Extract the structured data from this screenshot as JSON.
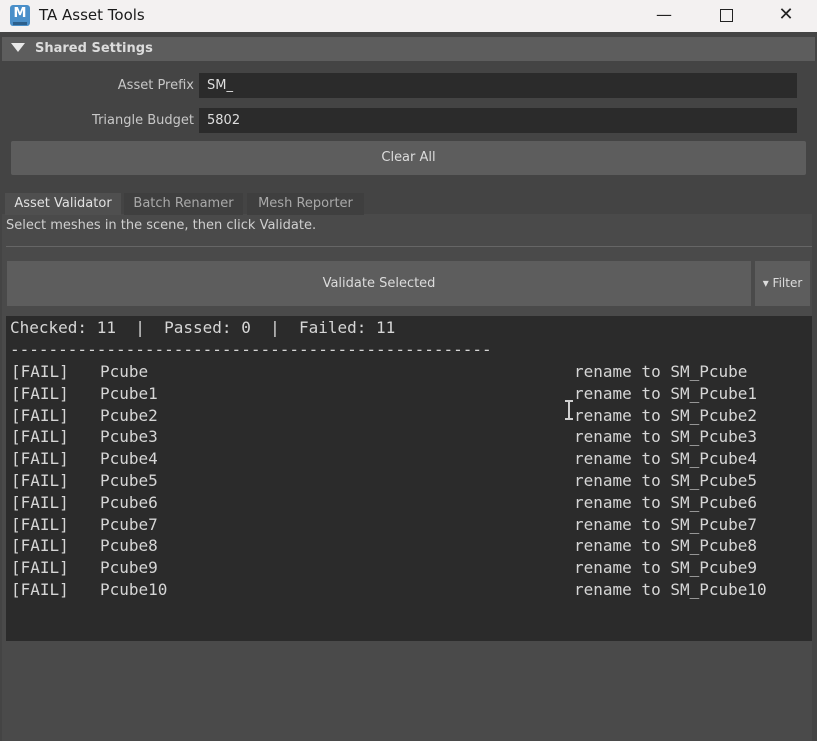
{
  "window": {
    "title": "TA Asset Tools",
    "app_icon": "maya-icon",
    "app_icon_letter": "M",
    "minimize_icon": "—",
    "close_icon": "✕"
  },
  "shared_settings": {
    "header": "Shared Settings",
    "asset_prefix_label": "Asset Prefix",
    "asset_prefix_value": "SM_",
    "triangle_budget_label": "Triangle Budget",
    "triangle_budget_value": "5802",
    "clear_all_label": "Clear All"
  },
  "tabs": [
    {
      "label": "Asset Validator",
      "active": true
    },
    {
      "label": "Batch Renamer",
      "active": false
    },
    {
      "label": "Mesh Reporter",
      "active": false
    }
  ],
  "validator": {
    "hint": "Select meshes in the scene, then click Validate.",
    "validate_label": "Validate Selected",
    "filter_label": "▾ Filter",
    "summary": "Checked: 11  |  Passed: 0  |  Failed: 11",
    "rule": "--------------------------------------------------",
    "results": [
      {
        "status": "[FAIL]",
        "name": "Pcube",
        "action": "rename to SM_Pcube"
      },
      {
        "status": "[FAIL]",
        "name": "Pcube1",
        "action": "rename to SM_Pcube1"
      },
      {
        "status": "[FAIL]",
        "name": "Pcube2",
        "action": "rename to SM_Pcube2"
      },
      {
        "status": "[FAIL]",
        "name": "Pcube3",
        "action": "rename to SM_Pcube3"
      },
      {
        "status": "[FAIL]",
        "name": "Pcube4",
        "action": "rename to SM_Pcube4"
      },
      {
        "status": "[FAIL]",
        "name": "Pcube5",
        "action": "rename to SM_Pcube5"
      },
      {
        "status": "[FAIL]",
        "name": "Pcube6",
        "action": "rename to SM_Pcube6"
      },
      {
        "status": "[FAIL]",
        "name": "Pcube7",
        "action": "rename to SM_Pcube7"
      },
      {
        "status": "[FAIL]",
        "name": "Pcube8",
        "action": "rename to SM_Pcube8"
      },
      {
        "status": "[FAIL]",
        "name": "Pcube9",
        "action": "rename to SM_Pcube9"
      },
      {
        "status": "[FAIL]",
        "name": "Pcube10",
        "action": "rename to SM_Pcube10"
      }
    ]
  }
}
